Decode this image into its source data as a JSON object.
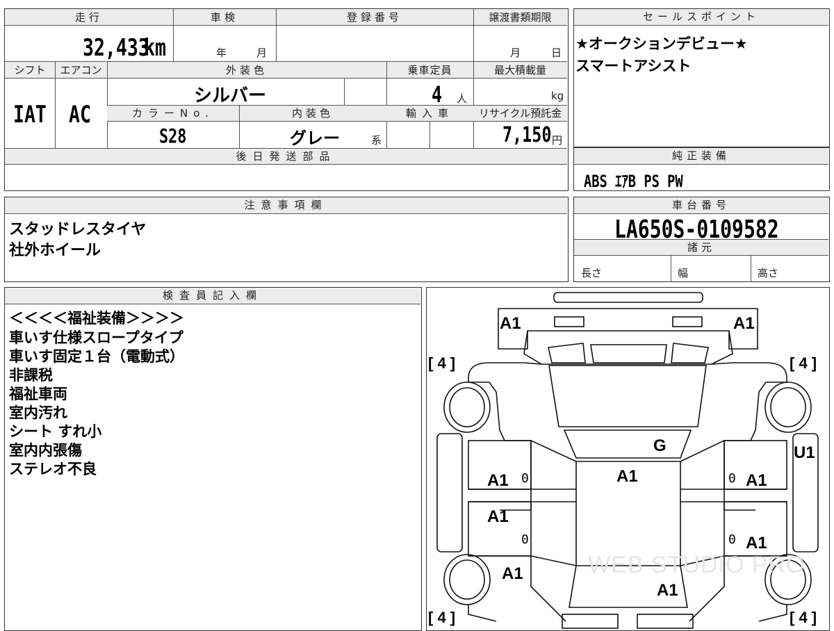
{
  "top_panel": {
    "mileage_label": "走行",
    "mileage_value": "32,433",
    "mileage_unit": "km",
    "inspection_label": "車検",
    "inspection_year": "年",
    "inspection_month": "月",
    "registration_label": "登録番号",
    "transfer_label": "譲渡書類期限",
    "transfer_month": "月",
    "transfer_day": "日",
    "shift_label": "シフト",
    "shift_value": "IAT",
    "ac_label": "エアコン",
    "ac_value": "AC",
    "exterior_color_label": "外装色",
    "exterior_color_value": "シルバー",
    "capacity_label": "乗車定員",
    "capacity_value": "4",
    "capacity_unit": "人",
    "max_load_label": "最大積載量",
    "max_load_unit": "kg",
    "color_no_label": "カラーNo.",
    "color_no_value": "S28",
    "interior_color_label": "内装色",
    "interior_color_value": "グレー",
    "interior_color_suffix": "系",
    "import_label": "輸入車",
    "recycle_label": "リサイクル預託金",
    "recycle_value": "7,150",
    "recycle_unit": "円",
    "later_parts_label": "後日発送部品"
  },
  "sales_points": {
    "header": "セールスポイント",
    "lines": [
      "★オークションデビュー★",
      "スマートアシスト"
    ]
  },
  "genuine_equipment": {
    "header": "純正装備",
    "value": "ABS ｴｱB PS PW"
  },
  "notes": {
    "header": "注意事項欄",
    "lines": [
      "スタッドレスタイヤ",
      "社外ホイール"
    ]
  },
  "chassis": {
    "header": "車台番号",
    "value": "LA650S-0109582",
    "spec_header": "諸元",
    "length_label": "長さ",
    "width_label": "幅",
    "height_label": "高さ"
  },
  "inspector": {
    "header": "検査員記入欄",
    "lines": [
      "＜＜＜＜福祉装備＞＞＞＞",
      "車いす仕様スロープタイプ",
      "車いす固定１台（電動式）",
      "非課税",
      "福祉車両",
      "室内汚れ",
      "シート すれ小",
      "室内内張傷",
      "ステレオ不良"
    ]
  },
  "diagram": {
    "tire_tl": "[ 4 ]",
    "tire_tr": "[ 4 ]",
    "tire_bl": "[ 4 ]",
    "tire_br": "[ 4 ]",
    "front_left": "A1",
    "front_right": "A1",
    "windshield": "G",
    "roof": "A1",
    "right_side": "U1",
    "left_front_door": "A1",
    "left_rear_door": "A1",
    "right_front_door": "A1",
    "right_rear_door": "A1",
    "left_rear_quarter": "A1",
    "rear_hatch": "A1",
    "zero_marks": [
      "0",
      "0",
      "0",
      "0"
    ],
    "watermark": "WEB STUDIO PRO"
  },
  "colors": {
    "header_bg": "#ececec",
    "border": "#333333"
  }
}
